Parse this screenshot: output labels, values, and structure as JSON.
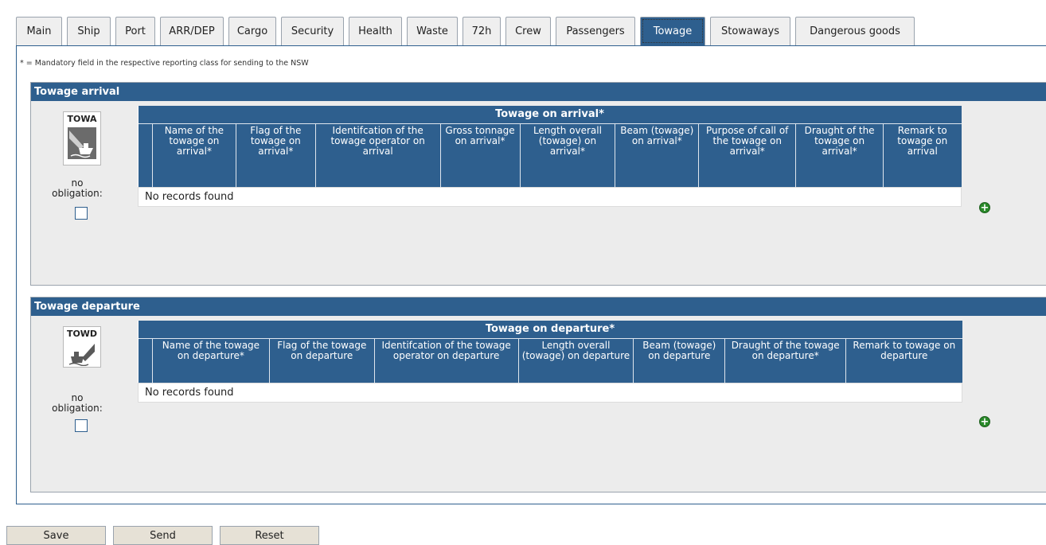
{
  "tabs": [
    "Main",
    "Ship",
    "Port",
    "ARR/DEP",
    "Cargo",
    "Security",
    "Health",
    "Waste",
    "72h",
    "Crew",
    "Passengers",
    "Towage",
    "Stowaways",
    "Dangerous goods"
  ],
  "active_tab": "Towage",
  "mandatory_note": "* = Mandatory field in the respective reporting class for sending to the NSW",
  "arrival": {
    "title": "Towage arrival",
    "icon_code": "TOWA",
    "no_obligation": "no obligation:",
    "group_title": "Towage on arrival*",
    "columns": [
      "Name of the towage on arrival*",
      "Flag of the towage on arrival*",
      "Identifcation of the towage operator on arrival",
      "Gross tonnage on arrival*",
      "Length overall (towage) on arrival*",
      "Beam (towage) on arrival*",
      "Purpose of call of the towage on arrival*",
      "Draught of the towage on arrival*",
      "Remark to towage on arrival"
    ],
    "empty_text": "No records found"
  },
  "departure": {
    "title": "Towage departure",
    "icon_code": "TOWD",
    "no_obligation": "no obligation:",
    "group_title": "Towage on departure*",
    "columns": [
      "Name of the towage on departure*",
      "Flag of the towage on departure",
      "Identifcation of the towage operator on departure",
      "Length overall (towage) on departure",
      "Beam (towage) on departure",
      "Draught of the towage on departure*",
      "Remark to towage on departure"
    ],
    "empty_text": "No records found"
  },
  "footer": {
    "save": "Save",
    "send": "Send",
    "reset": "Reset"
  },
  "colors": {
    "primary": "#2e5f8e",
    "panel_bg": "#ececec",
    "add_green": "#2a8a2a"
  }
}
